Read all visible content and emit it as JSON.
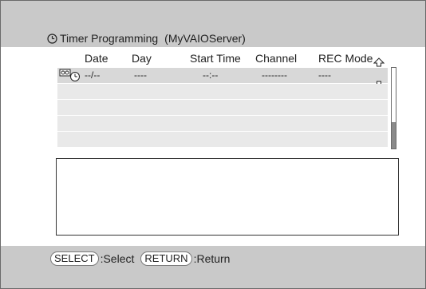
{
  "title": {
    "label": "Timer Programming",
    "server": "(MyVAIOServer)",
    "icon": "clock-icon"
  },
  "list": {
    "columns": [
      "Date",
      "Day",
      "Start Time",
      "Channel",
      "REC Mode"
    ],
    "rows": [
      {
        "icon": "timer-recording-icon",
        "date": "--/--",
        "day": "----",
        "start_time": "--:--",
        "channel": "--------",
        "rec_mode": "----"
      }
    ]
  },
  "hints": {
    "select_key": "SELECT",
    "select_label": ":Select",
    "return_key": "RETURN",
    "return_label": ":Return"
  },
  "colors": {
    "band": "#c9c9c9",
    "row": "#e9e9e9",
    "row_selected": "#d8d8d8"
  }
}
